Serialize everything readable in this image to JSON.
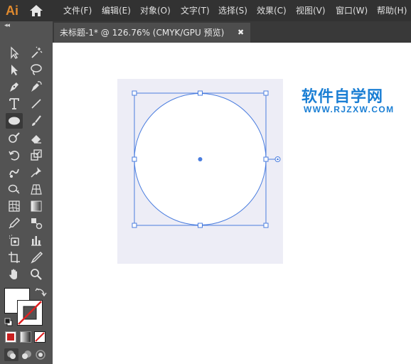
{
  "app": {
    "logo_text": "Ai"
  },
  "menu": {
    "items": [
      {
        "label": "文件(F)"
      },
      {
        "label": "编辑(E)"
      },
      {
        "label": "对象(O)"
      },
      {
        "label": "文字(T)"
      },
      {
        "label": "选择(S)"
      },
      {
        "label": "效果(C)"
      },
      {
        "label": "视图(V)"
      },
      {
        "label": "窗口(W)"
      },
      {
        "label": "帮助(H)"
      }
    ]
  },
  "tools_panel": {
    "collapse_glyph": "◂◂",
    "active_tool": "ellipse-tool",
    "tools": [
      "selection-tool",
      "magic-wand-tool",
      "direct-selection-tool",
      "lasso-tool",
      "pen-tool",
      "curvature-tool",
      "type-tool",
      "line-segment-tool",
      "ellipse-tool",
      "paintbrush-tool",
      "shaper-tool",
      "eraser-tool",
      "rotate-tool",
      "scale-tool",
      "warp-tool",
      "puppet-warp-tool",
      "shape-builder-tool",
      "perspective-grid-tool",
      "mesh-tool",
      "gradient-tool",
      "eyedropper-tool",
      "blend-tool",
      "symbol-sprayer-tool",
      "column-graph-tool",
      "artboard-tool",
      "slice-tool",
      "hand-tool",
      "zoom-tool"
    ],
    "fill_color": "#ffffff",
    "stroke_color": "none",
    "accent_red": "#e02020"
  },
  "document": {
    "tab_title": "未标题-1* @ 126.76% (CMYK/GPU 预览)",
    "close_glyph": "✖"
  },
  "canvas": {
    "artboard_color": "#ededf6",
    "selection_color": "#4a7ddf"
  },
  "watermark": {
    "cn": "软件自学网",
    "en": "WWW.RJZXW.COM",
    "color": "#1b7fd4"
  }
}
